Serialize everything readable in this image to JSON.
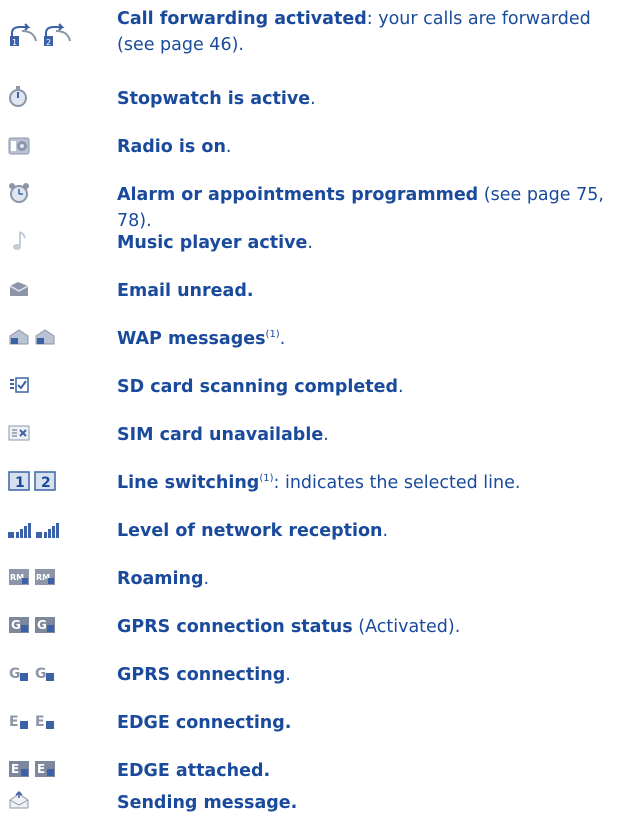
{
  "colors": {
    "text": "#1a4a9c",
    "icon_blue": "#3b62a8",
    "icon_gray": "#8c96a8"
  },
  "rows": [
    {
      "icons": [
        "call-forward-line1-icon",
        "call-forward-line2-icon"
      ],
      "bold": "Call forwarding activated",
      "rest": ": your calls are forwarded",
      "line2": "(see page 46)."
    },
    {
      "icons": [
        "stopwatch-icon"
      ],
      "bold": "Stopwatch is active",
      "rest": "."
    },
    {
      "icons": [
        "radio-icon"
      ],
      "bold": "Radio is on",
      "rest": "."
    },
    {
      "icons": [
        "alarm-clock-icon"
      ],
      "bold": "Alarm or appointments programmed",
      "rest": " (see page 75, 78)."
    },
    {
      "icons": [
        "music-note-icon"
      ],
      "bold": "Music player active",
      "rest": "."
    },
    {
      "icons": [
        "email-icon"
      ],
      "bold": "Email unread.",
      "rest": ""
    },
    {
      "icons": [
        "wap-message-icon",
        "wap-message-icon"
      ],
      "bold": "WAP messages",
      "sup": "(1)",
      "rest": "."
    },
    {
      "icons": [
        "sd-scan-complete-icon"
      ],
      "bold": "SD card scanning completed",
      "rest": "."
    },
    {
      "icons": [
        "sim-unavailable-icon"
      ],
      "bold": "SIM card unavailable",
      "rest": "."
    },
    {
      "icons": [
        "line-1-icon",
        "line-2-icon"
      ],
      "bold": "Line switching",
      "sup": "(1)",
      "rest": ": indicates the selected line."
    },
    {
      "icons": [
        "signal-line1-icon",
        "signal-line2-icon"
      ],
      "bold": "Level of network reception",
      "rest": "."
    },
    {
      "icons": [
        "roaming-line1-icon",
        "roaming-line2-icon"
      ],
      "bold": "Roaming",
      "rest": "."
    },
    {
      "icons": [
        "gprs-status-line1-icon",
        "gprs-status-line2-icon"
      ],
      "bold": "GPRS connection status",
      "rest": " (Activated)."
    },
    {
      "icons": [
        "gprs-connecting-line1-icon",
        "gprs-connecting-line2-icon"
      ],
      "bold": "GPRS connecting",
      "rest": "."
    },
    {
      "icons": [
        "edge-connecting-line1-icon",
        "edge-connecting-line2-icon"
      ],
      "bold": "EDGE connecting.",
      "rest": ""
    },
    {
      "icons": [
        "edge-attached-line1-icon",
        "edge-attached-line2-icon"
      ],
      "bold": "EDGE attached.",
      "rest": ""
    },
    {
      "icons": [
        "sending-message-icon"
      ],
      "bold": "Sending message.",
      "rest": ""
    }
  ]
}
